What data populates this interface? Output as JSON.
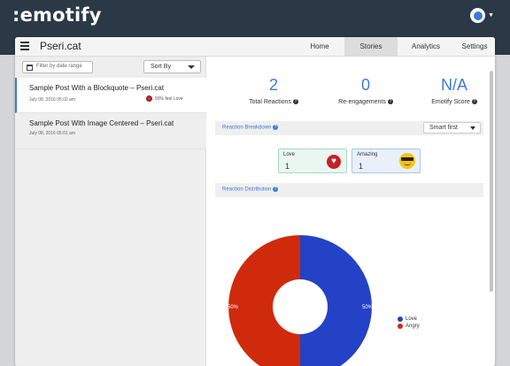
{
  "app": {
    "brand": ":emotify"
  },
  "header": {
    "site_title": "Pseri.cat",
    "tabs": [
      {
        "label": "Home"
      },
      {
        "label": "Stories",
        "active": true
      },
      {
        "label": "Analytics"
      },
      {
        "label": "Settings"
      }
    ]
  },
  "sidebar": {
    "filter_placeholder": "Filter by date range",
    "sort_label": "Sort By",
    "posts": [
      {
        "title": "Sample Post With a Blockquote – Pseri.cat",
        "date": "July 08, 2016 05:02 am",
        "badge": "50% feel Love",
        "badge_icon": "heart-icon"
      },
      {
        "title": "Sample Post With Image Centered – Pseri.cat",
        "date": "July 08, 2016 05:01 am"
      }
    ]
  },
  "stats": [
    {
      "value": "2",
      "label": "Total Reactions"
    },
    {
      "value": "0",
      "label": "Re-engagements"
    },
    {
      "value": "N/A",
      "label": "Emotify Score"
    }
  ],
  "breakdown": {
    "title": "Reaction Breakdown",
    "sort_value": "Smart first",
    "reactions": [
      {
        "name": "Love",
        "count": "1",
        "icon": "heart-icon",
        "color": "#c62027"
      },
      {
        "name": "Amazing",
        "count": "1",
        "icon": "sunglasses-face-icon",
        "color": "#f5c518"
      }
    ]
  },
  "distribution": {
    "title": "Reaction Distribution"
  },
  "colors": {
    "accent": "#3a7bd5",
    "topbar": "#2b3846",
    "love": "#2442c5",
    "angry": "#d02a0c"
  },
  "chart_data": {
    "type": "pie",
    "style": "donut",
    "title": "",
    "labels": [
      "Love",
      "Angry"
    ],
    "values": [
      50,
      50
    ],
    "data_labels": [
      "50%",
      "50%"
    ],
    "colors": [
      "#2442c5",
      "#d02a0c"
    ],
    "legend_position": "right"
  }
}
